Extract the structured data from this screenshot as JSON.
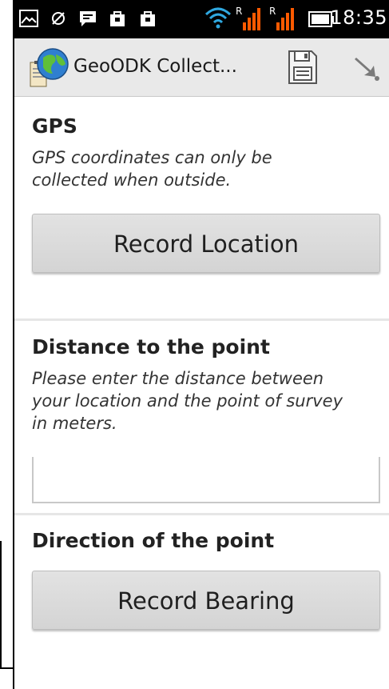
{
  "status_bar": {
    "time": "18:35",
    "icons": [
      "gallery-icon",
      "sync-icon",
      "chat-icon",
      "bag-icon",
      "bag-icon",
      "wifi-icon",
      "signal-icon",
      "signal-icon",
      "battery-icon"
    ],
    "roaming_label_1": "R",
    "roaming_label_2": "R"
  },
  "action_bar": {
    "title": "GeoODK Collect...",
    "save_icon": "save-icon",
    "next_icon": "arrow-icon"
  },
  "questions": [
    {
      "title": "GPS",
      "hint_lines": [
        "GPS coordinates can only be",
        "collected when outside."
      ],
      "button_label": "Record Location"
    },
    {
      "title": "Distance to the point",
      "hint_lines": [
        "Please enter the distance between",
        "your location and the point of survey",
        "in meters."
      ],
      "input_value": ""
    },
    {
      "title": "Direction of the point",
      "button_label": "Record Bearing"
    }
  ],
  "colors": {
    "status_bar_bg": "#000000",
    "action_bar_bg": "#e9e9e9",
    "wifi": "#2fa8e0",
    "signal": "#ff5a00",
    "button_bg": "#d9d9d9"
  }
}
